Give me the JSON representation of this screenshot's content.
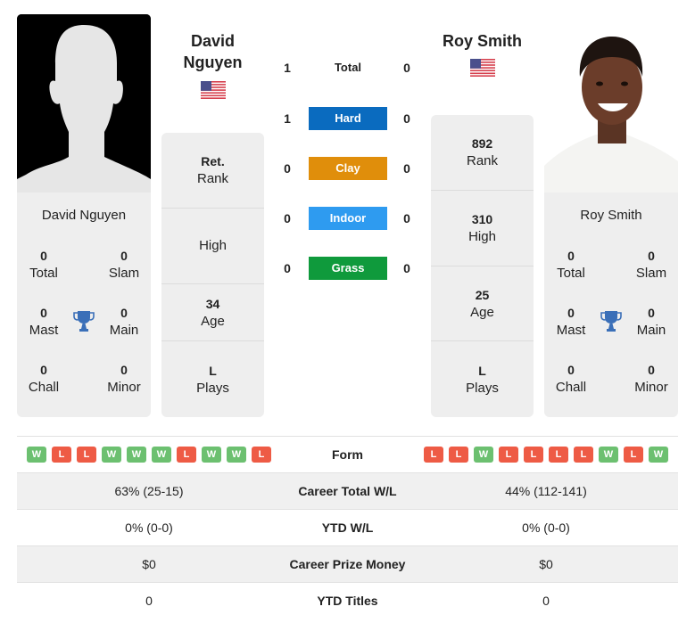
{
  "player_left": {
    "name": "David Nguyen",
    "name_line1": "David",
    "name_line2": "Nguyen",
    "flag": "us-flag-icon",
    "photo": "silhouette-placeholder",
    "titles": {
      "total": {
        "value": "0",
        "label": "Total"
      },
      "slam": {
        "value": "0",
        "label": "Slam"
      },
      "mast": {
        "value": "0",
        "label": "Mast"
      },
      "main": {
        "value": "0",
        "label": "Main"
      },
      "chall": {
        "value": "0",
        "label": "Chall"
      },
      "minor": {
        "value": "0",
        "label": "Minor"
      }
    },
    "info": {
      "rank": {
        "value": "Ret.",
        "label": "Rank"
      },
      "high": {
        "value": "",
        "label": "High"
      },
      "age": {
        "value": "34",
        "label": "Age"
      },
      "plays": {
        "value": "L",
        "label": "Plays"
      }
    },
    "form": [
      "W",
      "L",
      "L",
      "W",
      "W",
      "W",
      "L",
      "W",
      "W",
      "L"
    ]
  },
  "player_right": {
    "name": "Roy Smith",
    "flag": "us-flag-icon",
    "photo": "player-photo",
    "titles": {
      "total": {
        "value": "0",
        "label": "Total"
      },
      "slam": {
        "value": "0",
        "label": "Slam"
      },
      "mast": {
        "value": "0",
        "label": "Mast"
      },
      "main": {
        "value": "0",
        "label": "Main"
      },
      "chall": {
        "value": "0",
        "label": "Chall"
      },
      "minor": {
        "value": "0",
        "label": "Minor"
      }
    },
    "info": {
      "rank": {
        "value": "892",
        "label": "Rank"
      },
      "high": {
        "value": "310",
        "label": "High"
      },
      "age": {
        "value": "25",
        "label": "Age"
      },
      "plays": {
        "value": "L",
        "label": "Plays"
      }
    },
    "form": [
      "L",
      "L",
      "W",
      "L",
      "L",
      "L",
      "L",
      "W",
      "L",
      "W"
    ]
  },
  "h2h": [
    {
      "label": "Total",
      "left": "1",
      "right": "0",
      "color": ""
    },
    {
      "label": "Hard",
      "left": "1",
      "right": "0",
      "color": "#0a6bbf"
    },
    {
      "label": "Clay",
      "left": "0",
      "right": "0",
      "color": "#e08e0b"
    },
    {
      "label": "Indoor",
      "left": "0",
      "right": "0",
      "color": "#2e9bf0"
    },
    {
      "label": "Grass",
      "left": "0",
      "right": "0",
      "color": "#0f9a3c"
    }
  ],
  "stats": {
    "form_label": "Form",
    "rows": [
      {
        "label": "Career Total W/L",
        "left": "63% (25-15)",
        "right": "44% (112-141)"
      },
      {
        "label": "YTD W/L",
        "left": "0% (0-0)",
        "right": "0% (0-0)"
      },
      {
        "label": "Career Prize Money",
        "left": "$0",
        "right": "$0"
      },
      {
        "label": "YTD Titles",
        "left": "0",
        "right": "0"
      }
    ]
  },
  "colors": {
    "win": "#6cc070",
    "loss": "#ee5b45",
    "trophy": "#3a6fb8"
  }
}
